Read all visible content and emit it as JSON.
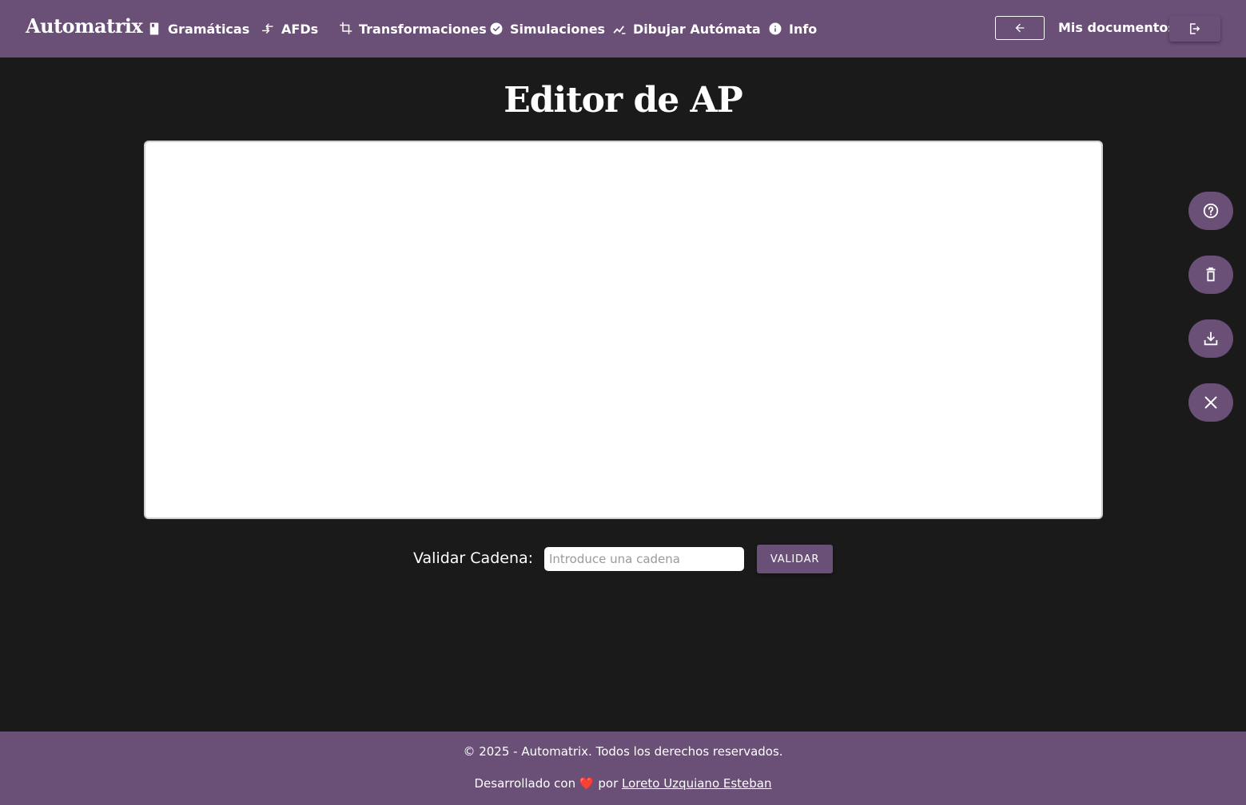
{
  "brand": "Automatrix",
  "nav": {
    "items": [
      {
        "label": "Gramáticas",
        "icon": "book-icon"
      },
      {
        "label": "AFDs",
        "icon": "arrows-icon"
      },
      {
        "label": "Transformaciones",
        "icon": "crop-icon"
      },
      {
        "label": "Simulaciones",
        "icon": "check-circle-icon"
      },
      {
        "label": "Dibujar Autómata",
        "icon": "draw-icon"
      },
      {
        "label": "Info",
        "icon": "info-icon"
      }
    ],
    "docs_label": "Mis documentos"
  },
  "page": {
    "title": "Editor de AP"
  },
  "validate": {
    "label": "Validar Cadena:",
    "placeholder": "Introduce una cadena",
    "value": "",
    "button_label": "VALIDAR"
  },
  "fabs": [
    "help-icon",
    "trash-icon",
    "download-icon",
    "close-icon"
  ],
  "footer": {
    "copyright": "© 2025 - Automatrix. Todos los derechos reservados.",
    "made_prefix": "Desarrollado con",
    "heart": "❤️",
    "made_by": "por",
    "author": "Loreto Uzquiano Esteban"
  },
  "colors": {
    "accent": "#6a4f77",
    "background": "#1a1a1a",
    "canvas": "#ffffff"
  }
}
